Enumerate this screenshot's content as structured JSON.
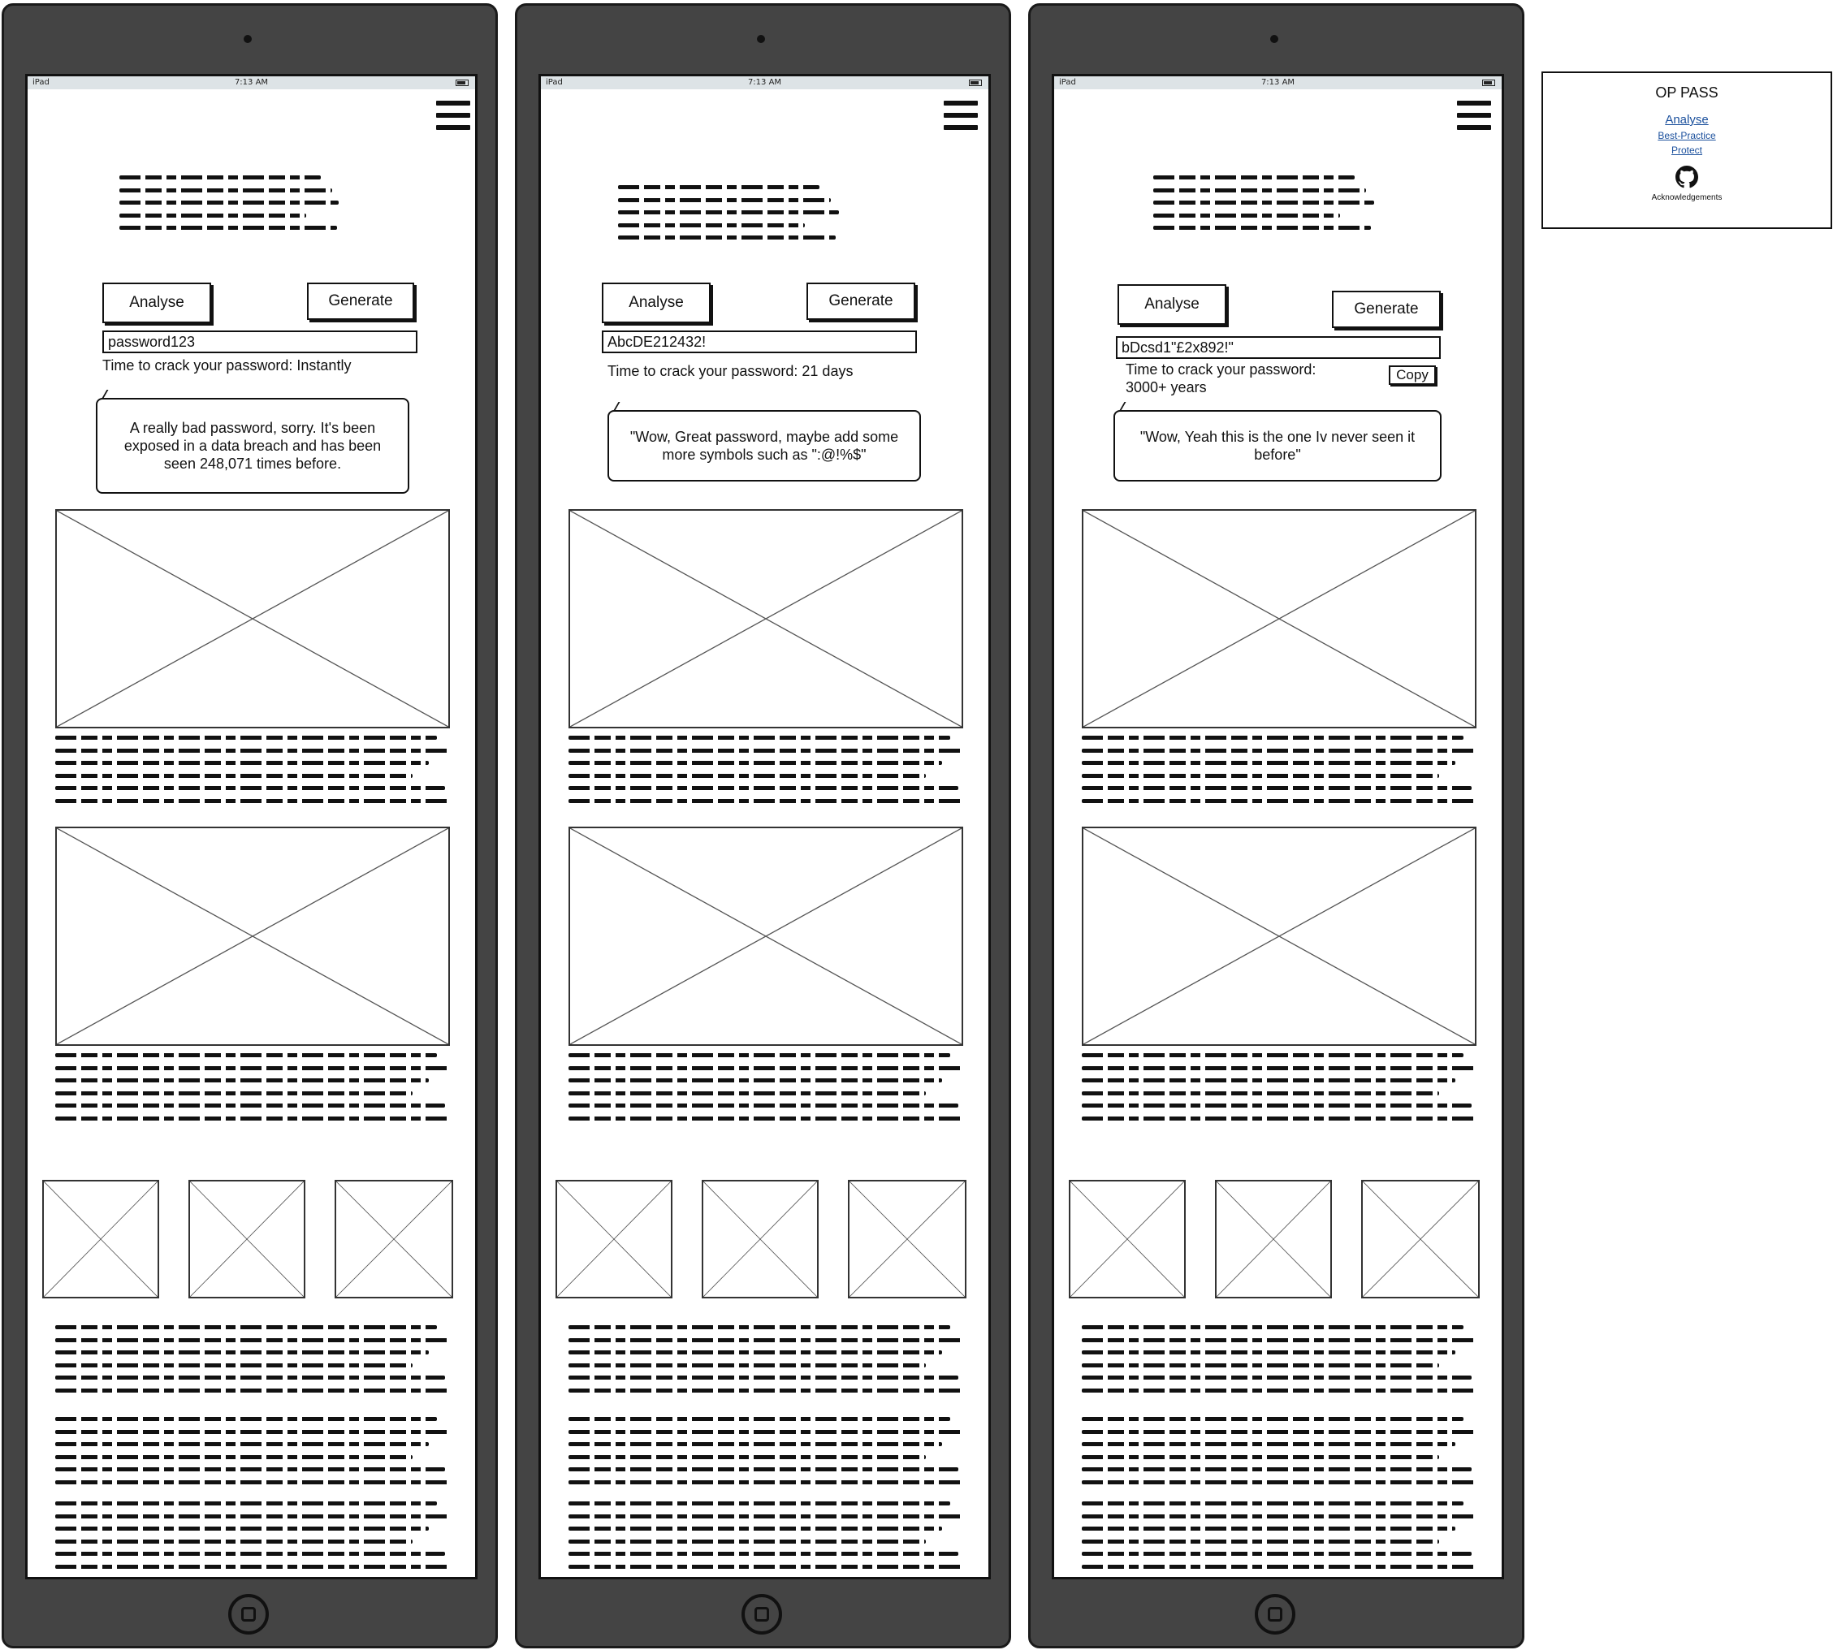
{
  "devices": [
    {
      "status": {
        "carrier": "iPad",
        "time": "7:13 AM"
      },
      "buttons": {
        "analyse": "Analyse",
        "generate": "Generate"
      },
      "password_value": "password123",
      "crack_time": "Time to crack your password: Instantly",
      "feedback": "A really bad password, sorry. It's been exposed in a data breach and has been seen 248,071 times before."
    },
    {
      "status": {
        "carrier": "iPad",
        "time": "7:13 AM"
      },
      "buttons": {
        "analyse": "Analyse",
        "generate": "Generate"
      },
      "password_value": "AbcDE212432!",
      "crack_time": "Time to crack your password: 21 days",
      "feedback": "\"Wow, Great password, maybe add some more symbols such as \":@!%$\""
    },
    {
      "status": {
        "carrier": "iPad",
        "time": "7:13 AM"
      },
      "buttons": {
        "analyse": "Analyse",
        "generate": "Generate",
        "copy": "Copy"
      },
      "password_value": "bDcsd1\"£2x892!\"",
      "crack_time": "Time to crack your password:",
      "crack_time_value": "3000+ years",
      "feedback": "\"Wow, Yeah this is the one Iv never seen it before\""
    }
  ],
  "menu_card": {
    "title": "OP PASS",
    "links": [
      "Analyse",
      "Best-Practice",
      "Protect"
    ],
    "icon": "github-icon",
    "footer": "Acknowledgements"
  },
  "colors": {
    "device_frame": "#444444",
    "status_bar": "#dde3e6",
    "link": "#1a4f9c"
  }
}
